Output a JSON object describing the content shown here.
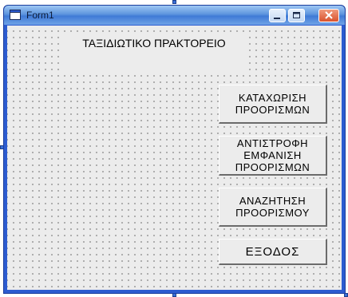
{
  "window": {
    "title": "Form1"
  },
  "form": {
    "heading": "ΤΑΞΙΔΙΩΤΙΚΟ ΠΡΑΚΤΟΡΕΙΟ",
    "buttons": [
      {
        "label": "ΚΑΤΑΧΩΡΙΣΗ\nΠΡΟΟΡΙΣΜΩΝ"
      },
      {
        "label": "ΑΝΤΙΣΤΡΟΦΗ\nΕΜΦΑΝΙΣΗ\nΠΡΟΟΡΙΣΜΩΝ"
      },
      {
        "label": "ΑΝΑΖΗΤΗΣΗ\nΠΡΟΟΡΙΣΜΟΥ"
      },
      {
        "label": "ΕΞΟΔΟΣ"
      }
    ]
  },
  "icons": {
    "app": "form-window-icon",
    "minimize": "minimize-icon",
    "maximize": "maximize-icon",
    "close": "close-icon"
  },
  "colors": {
    "titlebar": "#3f7ad6",
    "client_background": "#ececec",
    "close_button": "#d9532e"
  }
}
